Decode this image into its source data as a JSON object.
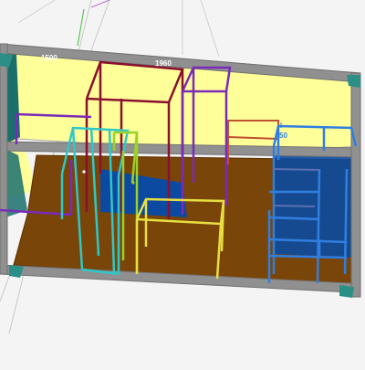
{
  "dimensions": {
    "width_left": "1500",
    "width_middle": "1960",
    "height_right": "50"
  },
  "colors": {
    "background": "#f4f4f4",
    "wall_yellow": "#ffff9a",
    "floor_brown": "#7a4508",
    "wall_dark": "#1a6e6c",
    "frame_gray": "#909090",
    "panel_blue": "#0b4aa0",
    "ghost_line": "#c8c8c8",
    "axis_green": "#3fbf3f",
    "frame_red": "#8a1030",
    "frame_purple": "#7a2bb8",
    "frame_cyan": "#2fc7c7",
    "frame_lime": "#9bd12a",
    "frame_yellow": "#e7df42",
    "frame_blue": "#2f7fe0",
    "frame_slate": "#5b6fb0",
    "corner_teal": "#2c8f86"
  }
}
